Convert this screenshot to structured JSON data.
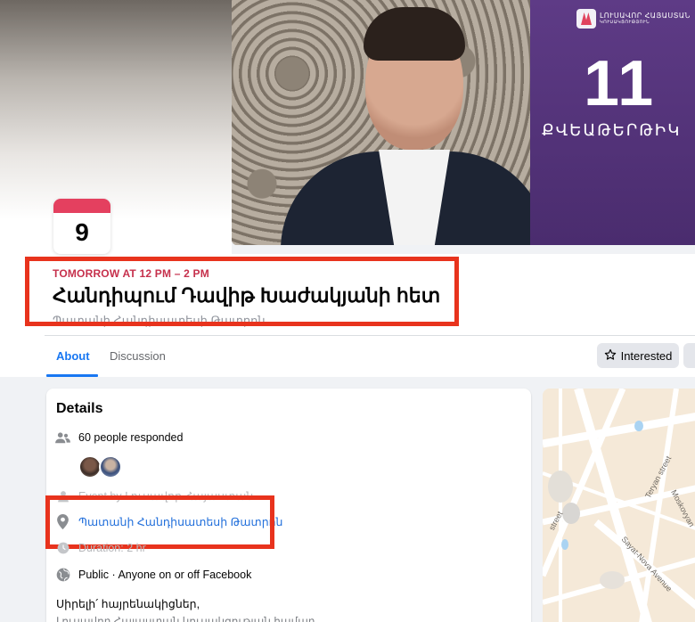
{
  "cover": {
    "brand_name": "ԼՈՒՍԱՎՈՐ ՀԱՅԱՍՏԱՆ",
    "brand_sub": "ԿՈՒՍԱԿՑՈՒԹՅՈՒՆ",
    "day": "11",
    "month": "ՔՎԵԱԹԵՐԹԻԿ"
  },
  "date_badge": {
    "day": "9"
  },
  "event": {
    "when": "TOMORROW AT 12 PM – 2 PM",
    "title": "Հանդիպում Դավիթ Խաժակյանի հետ",
    "subtitle": "Պատանի Հանդիսատեսի Թատրոն"
  },
  "tabs": [
    {
      "label": "About"
    },
    {
      "label": "Discussion"
    }
  ],
  "actions": {
    "interested_label": "Interested"
  },
  "details": {
    "title": "Details",
    "responded": "60 people responded",
    "host": "Event by Լուսավոր Հայաստան",
    "location": "Պատանի Հանդիսատեսի Թատրոն",
    "duration": "Duration: 2 hr",
    "privacy": "Public · Anyone on or off Facebook",
    "greeting": "Սիրելի՛ հայրենակիցներ,",
    "body_line": "Լուսավոր Հայաստան կուսակցության համար..."
  },
  "map": {
    "labels": [
      "Teryan street",
      "Moskovyan",
      "Sayat-Nova Avenue",
      "street"
    ]
  },
  "colors": {
    "accent": "#1877f2",
    "date_red": "#c6304c",
    "highlight": "#e8331d",
    "brand_purple": "#5e3b86"
  }
}
